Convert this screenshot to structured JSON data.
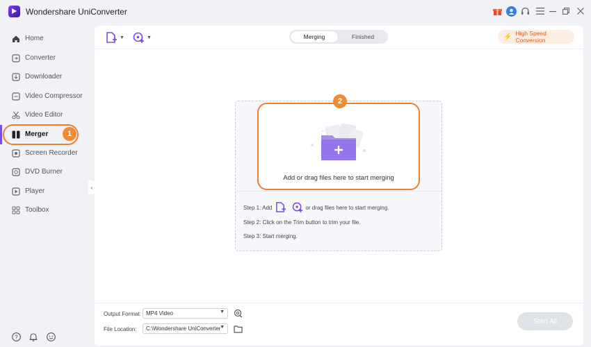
{
  "app": {
    "title": "Wondershare UniConverter"
  },
  "titlebar": {
    "icons": [
      "gift-icon",
      "user-avatar-icon",
      "headset-icon",
      "menu-icon",
      "minimize-icon",
      "maximize-icon",
      "close-icon"
    ]
  },
  "sidebar": {
    "items": [
      {
        "label": "Home",
        "icon": "home-icon"
      },
      {
        "label": "Converter",
        "icon": "converter-icon"
      },
      {
        "label": "Downloader",
        "icon": "downloader-icon"
      },
      {
        "label": "Video Compressor",
        "icon": "compressor-icon"
      },
      {
        "label": "Video Editor",
        "icon": "scissors-icon"
      },
      {
        "label": "Merger",
        "icon": "merger-icon",
        "active": true
      },
      {
        "label": "Screen Recorder",
        "icon": "screen-recorder-icon"
      },
      {
        "label": "DVD Burner",
        "icon": "dvd-icon"
      },
      {
        "label": "Player",
        "icon": "player-icon"
      },
      {
        "label": "Toolbox",
        "icon": "toolbox-icon"
      }
    ],
    "badge": "1",
    "bottom_icons": [
      "help-icon",
      "bell-icon",
      "feedback-icon"
    ]
  },
  "toolbar": {
    "tabs": {
      "merging": "Merging",
      "finished": "Finished"
    },
    "high_speed": "High Speed Conversion"
  },
  "dropzone": {
    "badge": "2",
    "text": "Add or drag files here to start merging",
    "step1_prefix": "Step 1: Add",
    "step1_suffix": "or drag files here to start merging.",
    "step2": "Step 2: Click on the Trim button to trim your file.",
    "step3": "Step 3: Start merging."
  },
  "bottom": {
    "output_format_label": "Output Format:",
    "output_format_value": "MP4 Video",
    "file_location_label": "File Location:",
    "file_location_value": "C:\\Wondershare UniConverter",
    "start_all": "Start All"
  },
  "colors": {
    "accent_purple": "#7b4de0",
    "highlight_orange": "#f07e2e",
    "badge_orange": "#f08a34",
    "high_speed_text": "#e25b1a"
  }
}
